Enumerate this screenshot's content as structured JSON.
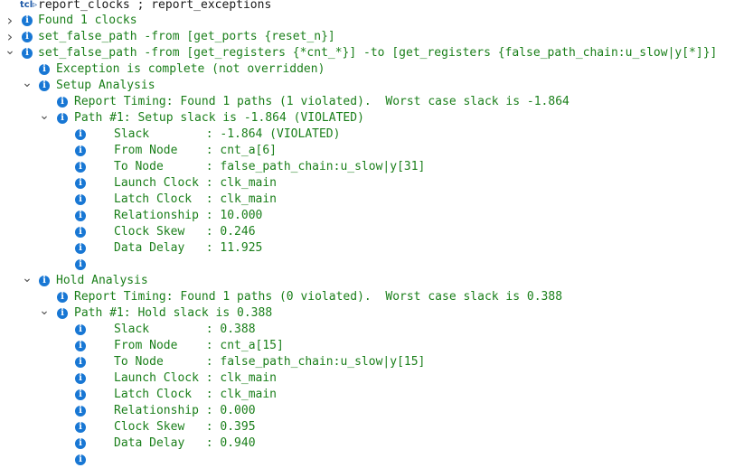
{
  "console": {
    "prompt_icon": "tcl-prompt-icon",
    "command": "report_clocks ; report_exceptions",
    "rows": [
      {
        "text": "Found 1 clocks",
        "level": 0,
        "chevron": "right",
        "icon": true
      },
      {
        "text": "set_false_path -from [get_ports {reset_n}]",
        "level": 0,
        "chevron": "right",
        "icon": true
      },
      {
        "text": "set_false_path -from [get_registers {*cnt_*}] -to [get_registers {false_path_chain:u_slow|y[*]}]",
        "level": 0,
        "chevron": "down",
        "icon": true
      },
      {
        "text": "Exception is complete (not overridden)",
        "level": 1,
        "chevron": "",
        "icon": true
      },
      {
        "text": "Setup Analysis",
        "level": 1,
        "chevron": "down",
        "icon": true
      },
      {
        "text": "Report Timing: Found 1 paths (1 violated).  Worst case slack is -1.864",
        "level": 2,
        "chevron": "",
        "icon": true
      },
      {
        "text": "Path #1: Setup slack is -1.864 (VIOLATED)",
        "level": 2,
        "chevron": "down",
        "icon": true
      },
      {
        "text": "Slack        : -1.864 (VIOLATED)",
        "level": 3,
        "chevron": "",
        "icon": true
      },
      {
        "text": "From Node    : cnt_a[6]",
        "level": 3,
        "chevron": "",
        "icon": true
      },
      {
        "text": "To Node      : false_path_chain:u_slow|y[31]",
        "level": 3,
        "chevron": "",
        "icon": true
      },
      {
        "text": "Launch Clock : clk_main",
        "level": 3,
        "chevron": "",
        "icon": true
      },
      {
        "text": "Latch Clock  : clk_main",
        "level": 3,
        "chevron": "",
        "icon": true
      },
      {
        "text": "Relationship : 10.000",
        "level": 3,
        "chevron": "",
        "icon": true
      },
      {
        "text": "Clock Skew   : 0.246",
        "level": 3,
        "chevron": "",
        "icon": true
      },
      {
        "text": "Data Delay   : 11.925",
        "level": 3,
        "chevron": "",
        "icon": true
      },
      {
        "text": "",
        "level": 3,
        "chevron": "",
        "icon": true
      },
      {
        "text": "Hold Analysis",
        "level": 1,
        "chevron": "down",
        "icon": true
      },
      {
        "text": "Report Timing: Found 1 paths (0 violated).  Worst case slack is 0.388",
        "level": 2,
        "chevron": "",
        "icon": true
      },
      {
        "text": "Path #1: Hold slack is 0.388",
        "level": 2,
        "chevron": "down",
        "icon": true
      },
      {
        "text": "Slack        : 0.388",
        "level": 3,
        "chevron": "",
        "icon": true
      },
      {
        "text": "From Node    : cnt_a[15]",
        "level": 3,
        "chevron": "",
        "icon": true
      },
      {
        "text": "To Node      : false_path_chain:u_slow|y[15]",
        "level": 3,
        "chevron": "",
        "icon": true
      },
      {
        "text": "Launch Clock : clk_main",
        "level": 3,
        "chevron": "",
        "icon": true
      },
      {
        "text": "Latch Clock  : clk_main",
        "level": 3,
        "chevron": "",
        "icon": true
      },
      {
        "text": "Relationship : 0.000",
        "level": 3,
        "chevron": "",
        "icon": true
      },
      {
        "text": "Clock Skew   : 0.395",
        "level": 3,
        "chevron": "",
        "icon": true
      },
      {
        "text": "Data Delay   : 0.940",
        "level": 3,
        "chevron": "",
        "icon": true
      },
      {
        "text": "",
        "level": 3,
        "chevron": "",
        "icon": true
      }
    ]
  }
}
